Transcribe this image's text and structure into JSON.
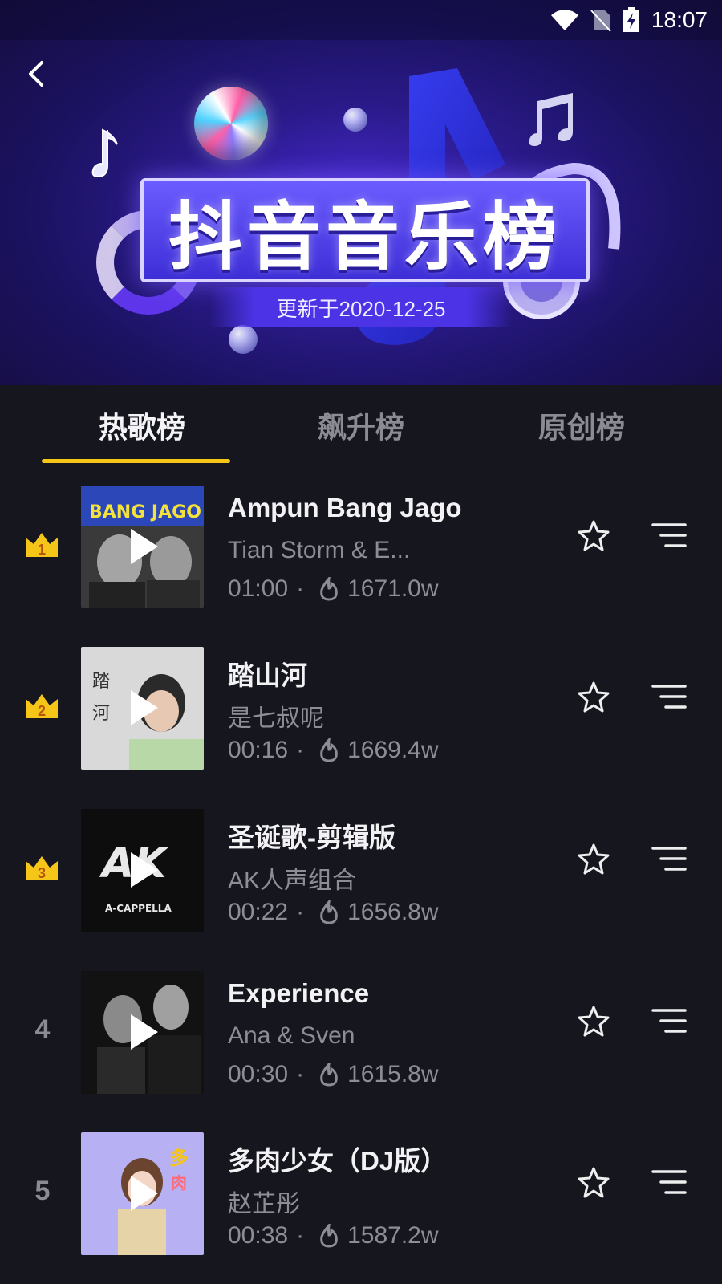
{
  "status": {
    "time": "18:07"
  },
  "banner": {
    "title": "抖音音乐榜",
    "updated": "更新于2020-12-25"
  },
  "tabs": [
    {
      "label": "热歌榜",
      "active": true
    },
    {
      "label": "飙升榜",
      "active": false
    },
    {
      "label": "原创榜",
      "active": false
    }
  ],
  "colors": {
    "accent": "#f5c518",
    "background": "#16161f",
    "crown": "#f5c518"
  },
  "songs": [
    {
      "rank": "1",
      "title": "Ampun Bang Jago",
      "artist": "Tian Storm & E...",
      "duration": "01:00",
      "heat": "1671.0w"
    },
    {
      "rank": "2",
      "title": "踏山河",
      "artist": "是七叔呢",
      "duration": "00:16",
      "heat": "1669.4w"
    },
    {
      "rank": "3",
      "title": "圣诞歌-剪辑版",
      "artist": "AK人声组合",
      "duration": "00:22",
      "heat": "1656.8w"
    },
    {
      "rank": "4",
      "title": "Experience",
      "artist": "Ana & Sven",
      "duration": "00:30",
      "heat": "1615.8w"
    },
    {
      "rank": "5",
      "title": "多肉少女（DJ版）",
      "artist": "赵芷彤",
      "duration": "00:38",
      "heat": "1587.2w"
    }
  ],
  "meta_separator": "·"
}
